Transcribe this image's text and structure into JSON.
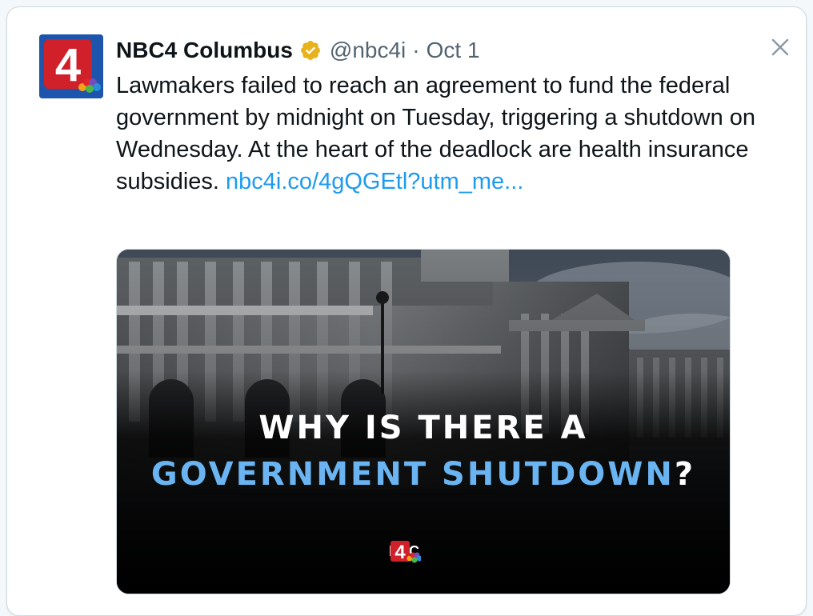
{
  "tweet": {
    "author_name": "NBC4 Columbus",
    "handle": "@nbc4i",
    "separator": "·",
    "date": "Oct 1",
    "body_text": "Lawmakers failed to reach an agreement to fund the federal government by midnight on Tuesday, triggering a shutdown on Wednesday. At the heart of the deadlock are health insurance subsidies. ",
    "link_text": "nbc4i.co/4gQGEtl?utm_me...",
    "avatar_label": "4"
  },
  "media": {
    "headline_line1": "WHY IS THERE A",
    "headline_line2": "GOVERNMENT SHUTDOWN",
    "headline_q": "?",
    "logo_text": "NBC",
    "logo_number": "4"
  },
  "icons": {
    "verified": "verified-badge-icon",
    "close": "close-icon"
  },
  "colors": {
    "link": "#1d9bf0",
    "headline_accent": "#6ab4f2",
    "verified": "#e8b21b",
    "avatar_red": "#d0202a",
    "avatar_blue": "#1c4c9c"
  }
}
